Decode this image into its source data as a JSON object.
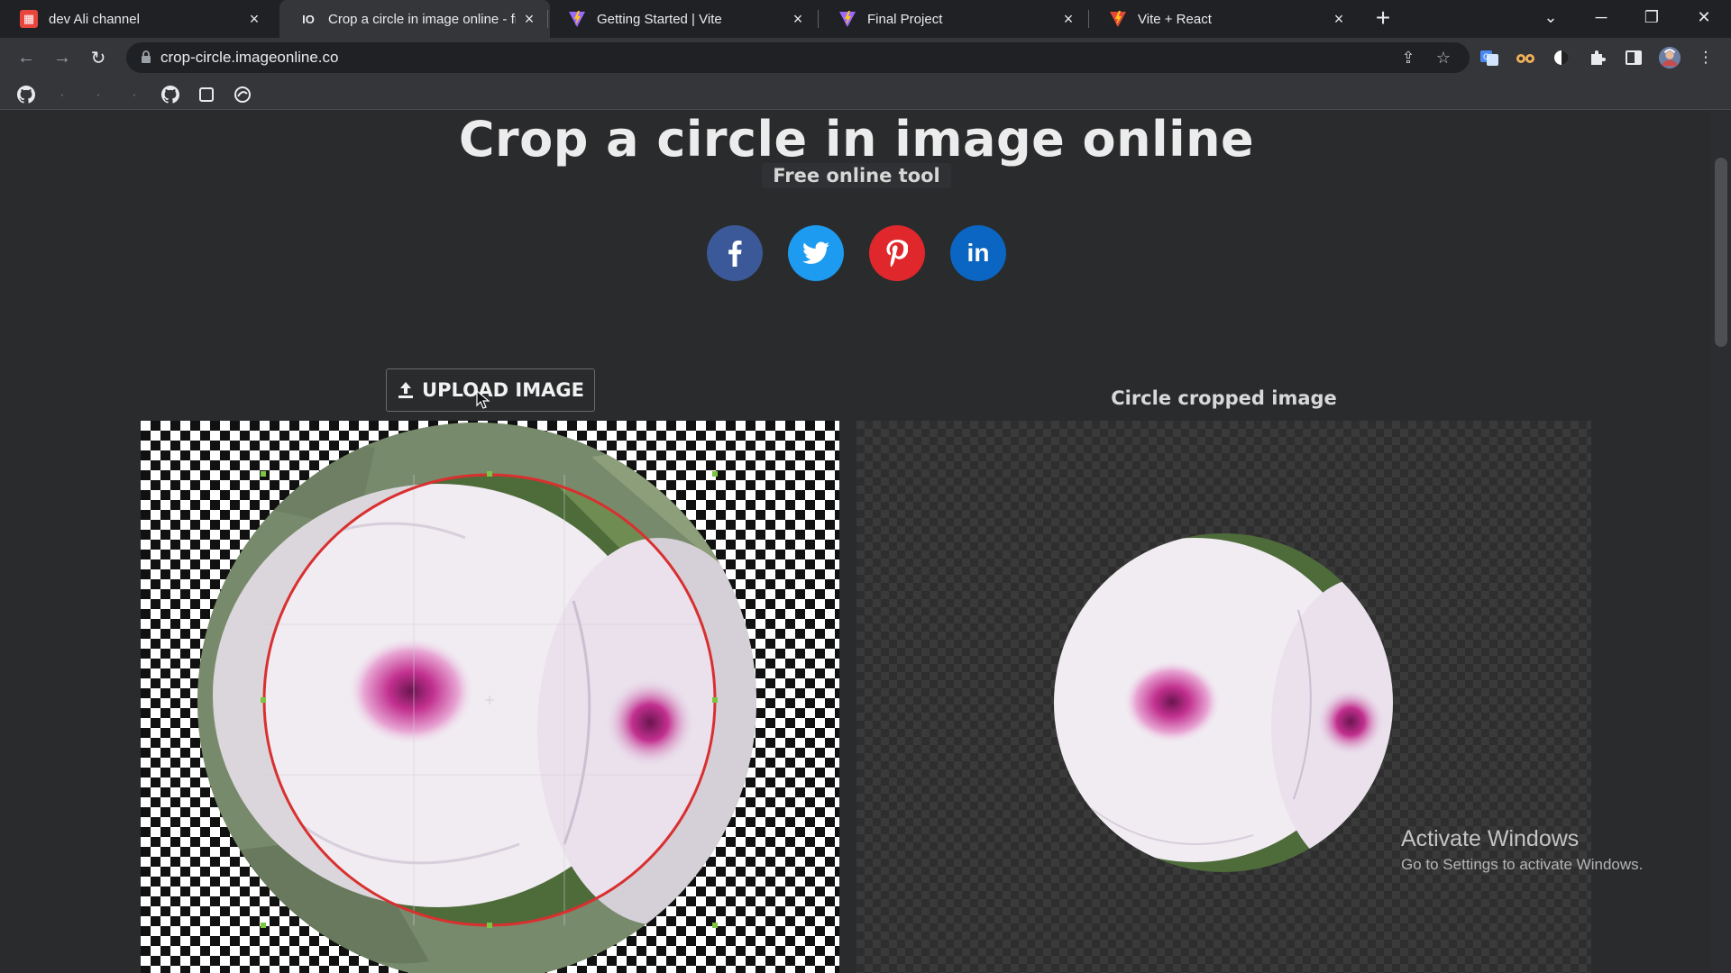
{
  "browser": {
    "tabs": [
      {
        "title": "dev Ali channel",
        "favicon": "red-app-icon",
        "active": false
      },
      {
        "title": "Crop a circle in image online - fr",
        "favicon": "io-icon",
        "active": true
      },
      {
        "title": "Getting Started | Vite",
        "favicon": "vite-icon",
        "active": false
      },
      {
        "title": "Final Project",
        "favicon": "vite-icon",
        "active": false
      },
      {
        "title": "Vite + React",
        "favicon": "vite-react-icon",
        "active": false
      }
    ],
    "favicon_text": {
      "io": "IO"
    },
    "url": "crop-circle.imageonline.co"
  },
  "page": {
    "title": "Crop a circle in image online",
    "subtitle": "Free online tool",
    "social": [
      {
        "name": "facebook",
        "glyph": "f",
        "color": "#3b5998"
      },
      {
        "name": "twitter",
        "glyph": "t",
        "color": "#1da1f2"
      },
      {
        "name": "pinterest",
        "glyph": "P",
        "color": "#e02a2a"
      },
      {
        "name": "linkedin",
        "glyph": "in",
        "color": "#0e76a8"
      }
    ],
    "upload_label": "UPLOAD IMAGE",
    "result_label": "Circle cropped image"
  },
  "os": {
    "watermark_title": "Activate Windows",
    "watermark_sub": "Go to Settings to activate Windows."
  },
  "colors": {
    "crop_ring": "#d9302f",
    "petal": "#ece6ee",
    "flower_center": "#c2308f",
    "leaf": "#4e6b3a"
  }
}
